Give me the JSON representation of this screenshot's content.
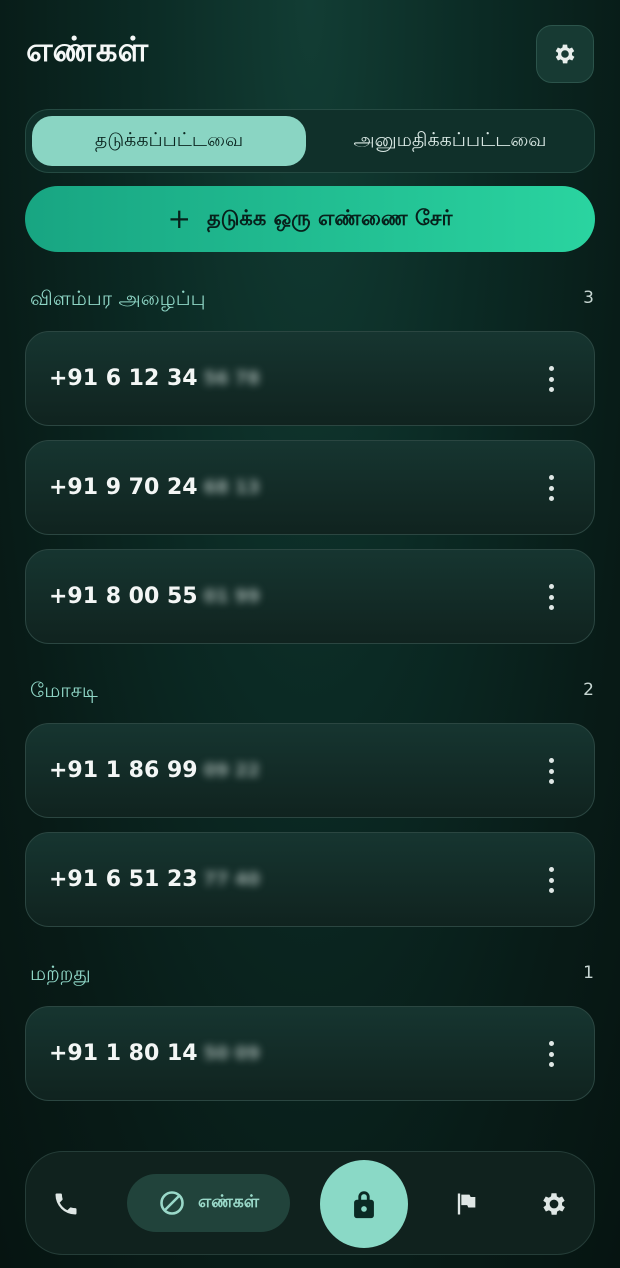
{
  "header": {
    "title": "எண்கள்"
  },
  "segments": {
    "active": "தடுக்கப்பட்டவை",
    "inactive": "அனுமதிக்கப்பட்டவை"
  },
  "add_button": {
    "label": "தடுக்க ஒரு எண்ணை சேர்",
    "icon": "plus-icon"
  },
  "categories": [
    {
      "label": "விளம்பர அழைப்பு",
      "count": "3",
      "numbers": [
        {
          "visible": "+91 6 12 34",
          "hidden": "56 78"
        },
        {
          "visible": "+91 9 70 24",
          "hidden": "68 13"
        },
        {
          "visible": "+91 8 00 55",
          "hidden": "01 99"
        }
      ]
    },
    {
      "label": "மோசடி",
      "count": "2",
      "numbers": [
        {
          "visible": "+91 1 86 99",
          "hidden": "09 22"
        },
        {
          "visible": "+91 6 51 23",
          "hidden": "77 40"
        }
      ]
    },
    {
      "label": "மற்றது",
      "count": "1",
      "numbers": [
        {
          "visible": "+91 1 80 14",
          "hidden": "50 09"
        }
      ]
    }
  ],
  "bottom_nav": {
    "active_label": "எண்கள்",
    "icons": [
      "phone-icon",
      "block-icon",
      "lock-icon",
      "flag-icon",
      "gear-icon"
    ]
  },
  "colors": {
    "accent": "#8ad5c3",
    "button_green": "#2ad4a0",
    "background": "#0b2a24"
  }
}
